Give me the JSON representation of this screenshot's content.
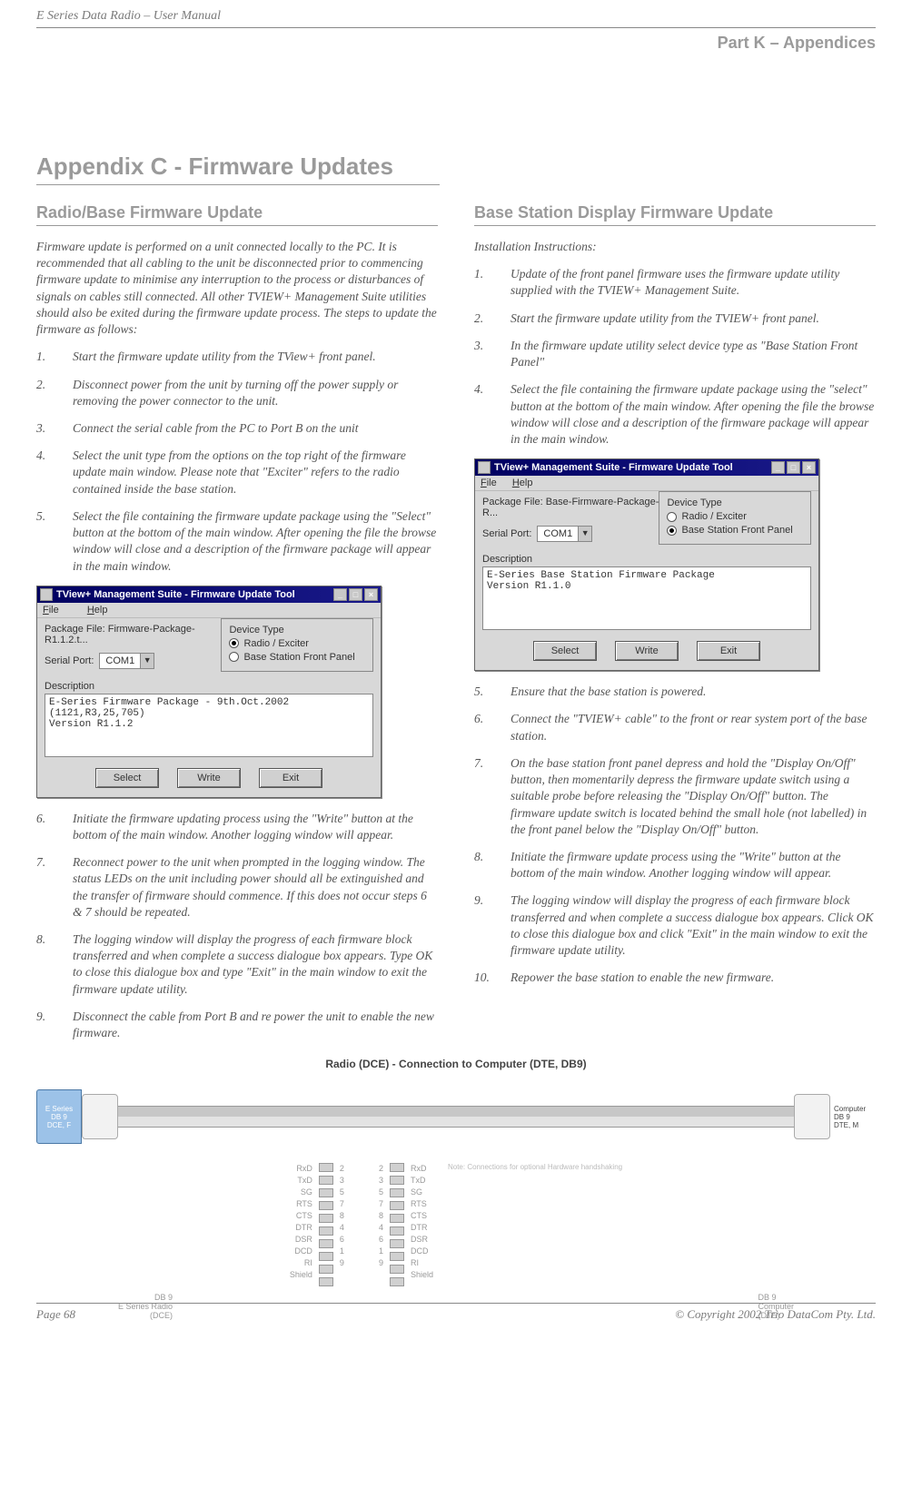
{
  "header": {
    "doc_title": "E Series Data Radio – User Manual",
    "part": "Part K – Appendices"
  },
  "appendix_title": "Appendix C - Firmware Updates",
  "left": {
    "heading": "Radio/Base Firmware Update",
    "intro": "Firmware update is performed on a unit connected locally to the PC. It is recommended that all cabling to the unit be disconnected prior to commencing firmware update to minimise any interruption to the process or disturbances of signals on cables still connected. All other TVIEW+ Management Suite utilities should also be exited during the firmware update process. The steps to update the firmware as follows:",
    "steps": [
      "Start the firmware update utility from the TView+ front panel.",
      "Disconnect power from the unit by turning off the power supply or removing the power connector to the unit.",
      "Connect the serial cable from the PC to Port B on the unit",
      "Select the unit type from the options on the top right of the firmware update main window. Please note that \"Exciter\" refers to the radio contained inside the base station.",
      "Select the file containing the firmware update package using the \"Select\" button at the bottom of the main window. After opening the file the browse window will close and a description of the firmware package will appear in the main window.",
      "Initiate the firmware updating process using the \"Write\" button at the bottom of the main window. Another logging window will appear.",
      "Reconnect power to the unit when prompted in the logging window. The status LEDs on the unit including power should all be extinguished and the transfer of firmware should commence. If this does not occur steps 6 & 7 should be repeated.",
      "The logging window will display the progress of each firmware block transferred and when complete a success dialogue box appears. Type OK to close this dialogue box and type \"Exit\" in the main window to exit the firmware update utility.",
      "Disconnect the cable from Port B and re power the unit to enable the new firmware."
    ],
    "dialog": {
      "title": "TView+ Management Suite - Firmware Update Tool",
      "menu": {
        "file": "File",
        "help": "Help"
      },
      "pkg_label": "Package File:",
      "pkg_value": "Firmware-Package-R1.1.2.t...",
      "devtype_legend": "Device Type",
      "radio1": "Radio / Exciter",
      "radio2": "Base Station Front Panel",
      "serial_label": "Serial Port:",
      "serial_value": "COM1",
      "desc_label": "Description",
      "desc_text": "E-Series Firmware Package - 9th.Oct.2002 (1121,R3,25,705)\nVersion R1.1.2",
      "btn_select": "Select",
      "btn_write": "Write",
      "btn_exit": "Exit"
    }
  },
  "right": {
    "heading": "Base Station Display Firmware Update",
    "intro": "Installation Instructions:",
    "steps": [
      "Update of the front panel firmware uses the firmware update utility supplied with the TVIEW+ Management Suite.",
      "Start the firmware update utility from the TVIEW+ front panel.",
      "In the firmware update utility select device type as \"Base Station Front Panel\"",
      "Select the file containing the firmware update package using the \"select\" button at the bottom of the main window. After opening the file the browse window will close and a description of the firmware package will appear in the main window.",
      "Ensure that the base station is powered.",
      "Connect the \"TVIEW+ cable\" to the front or rear system port of the base station.",
      "On the base station front panel depress and hold the \"Display On/Off\" button, then momentarily depress the firmware update switch using a suitable probe before releasing the \"Display On/Off\" button. The firmware update switch is located behind the small hole (not labelled) in the front panel below the \"Display On/Off\" button.",
      "Initiate the firmware update process using the \"Write\" button at the bottom of the main window. Another logging window will appear.",
      "The logging window will display the progress of each firmware block transferred and when complete a success dialogue box appears. Click OK to close this dialogue box and click \"Exit\" in the main window to exit the firmware update utility.",
      "Repower the base station to enable the new firmware."
    ],
    "dialog": {
      "title": "TView+ Management Suite - Firmware Update Tool",
      "menu": {
        "file": "File",
        "help": "Help"
      },
      "pkg_label": "Package File:",
      "pkg_value": "Base-Firmware-Package-R...",
      "devtype_legend": "Device Type",
      "radio1": "Radio / Exciter",
      "radio2": "Base Station Front Panel",
      "serial_label": "Serial Port:",
      "serial_value": "COM1",
      "desc_label": "Description",
      "desc_text": "E-Series Base Station Firmware Package\nVersion R1.1.0",
      "btn_select": "Select",
      "btn_write": "Write",
      "btn_exit": "Exit"
    }
  },
  "cable": {
    "caption": "Radio (DCE) - Connection to Computer (DTE, DB9)",
    "left_conn": "E Series\nDB 9\nDCE, F",
    "right_conn": "Computer\nDB 9\nDTE, M",
    "left_bottom": "DB 9\nE Series Radio\n(DCE)",
    "right_bottom": "DB 9\nComputer\n(DTE)",
    "note": "Note: Connections for optional Hardware handshaking",
    "pins_left": [
      "RxD",
      "TxD",
      "SG",
      "RTS",
      "CTS",
      "DTR",
      "DSR",
      "DCD",
      "RI",
      "Shield"
    ],
    "pins_numL": [
      "2",
      "3",
      "5",
      "7",
      "8",
      "4",
      "6",
      "1",
      "9",
      ""
    ],
    "pins_numR": [
      "2",
      "3",
      "5",
      "7",
      "8",
      "4",
      "6",
      "1",
      "9",
      ""
    ],
    "pins_right": [
      "RxD",
      "TxD",
      "SG",
      "RTS",
      "CTS",
      "DTR",
      "DSR",
      "DCD",
      "RI",
      "Shield"
    ]
  },
  "footer": {
    "page": "Page 68",
    "copyright": "© Copyright 2002 Trio DataCom Pty. Ltd."
  }
}
